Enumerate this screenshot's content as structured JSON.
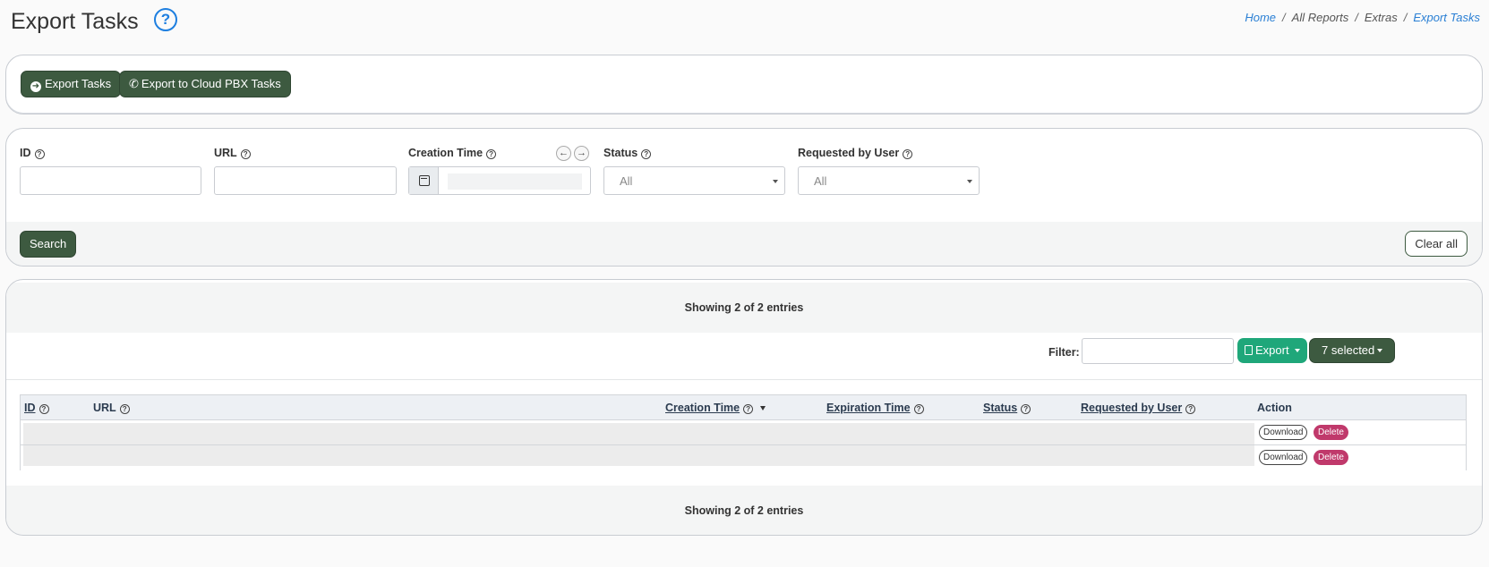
{
  "header": {
    "title": "Export Tasks",
    "help_glyph": "?",
    "breadcrumb": [
      "Home",
      "All Reports",
      "Extras",
      "Export Tasks"
    ],
    "breadcrumb_sep": "/"
  },
  "toolbar": {
    "export_tasks_label": "Export Tasks",
    "export_cloud_label": "Export to Cloud PBX Tasks"
  },
  "filters": {
    "id_label": "ID",
    "url_label": "URL",
    "creation_time_label": "Creation Time",
    "status_label": "Status",
    "status_value": "All",
    "requested_by_label": "Requested by User",
    "requested_by_value": "All",
    "search_label": "Search",
    "clear_label": "Clear all"
  },
  "table": {
    "info_top": "Showing 2 of 2 entries",
    "info_bottom": "Showing 2 of 2 entries",
    "filter_label": "Filter:",
    "export_label": "Export",
    "columns_selected_label": "7 selected",
    "columns": [
      "ID",
      "URL",
      "Creation Time",
      "Expiration Time",
      "Status",
      "Requested by User",
      "Action"
    ],
    "rows": [
      {
        "download_label": "Download",
        "delete_label": "Delete"
      },
      {
        "download_label": "Download",
        "delete_label": "Delete"
      }
    ]
  },
  "colors": {
    "primary_dark": "#3d5a40",
    "export_green": "#1fa77a",
    "delete_pink": "#c0396b",
    "link_blue": "#2a7fd4"
  }
}
